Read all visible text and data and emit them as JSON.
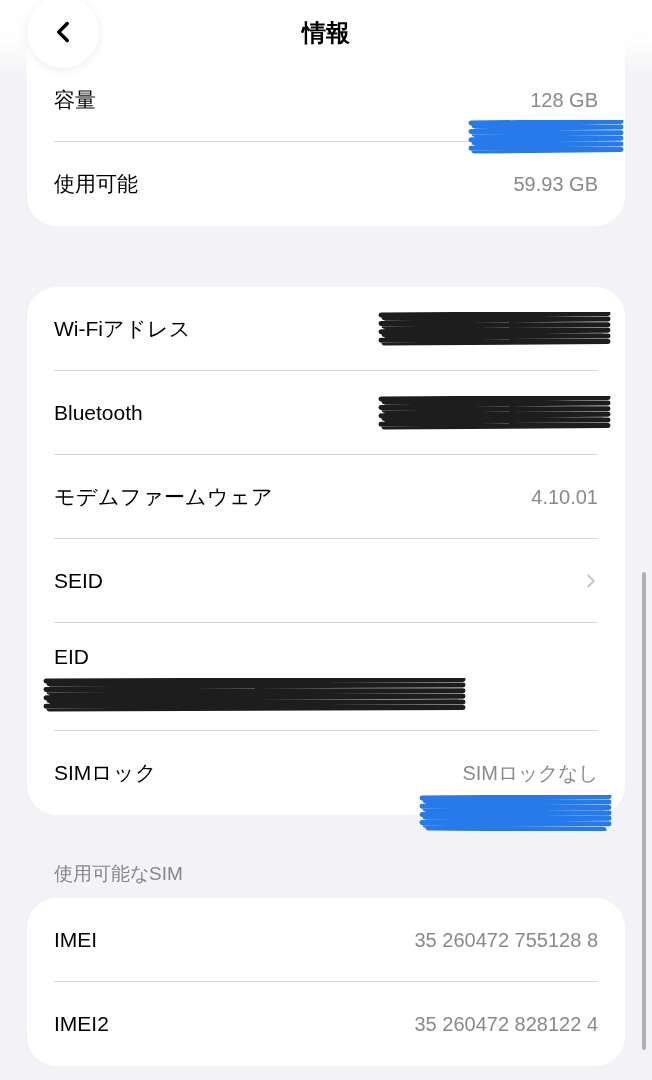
{
  "nav": {
    "title": "情報"
  },
  "cards": [
    {
      "rows": [
        {
          "kind": "value",
          "label": "容量",
          "value": "128 GB"
        },
        {
          "kind": "value",
          "label": "使用可能",
          "value": "59.93 GB"
        }
      ]
    },
    {
      "rows": [
        {
          "kind": "redacted",
          "label": "Wi-Fiアドレス"
        },
        {
          "kind": "redacted",
          "label": "Bluetooth"
        },
        {
          "kind": "value",
          "label": "モデムファームウェア",
          "value": "4.10.01"
        },
        {
          "kind": "link",
          "label": "SEID"
        },
        {
          "kind": "stacked",
          "label": "EID"
        },
        {
          "kind": "value",
          "label": "SIMロック",
          "value": "SIMロックなし"
        }
      ]
    },
    {
      "header": "使用可能なSIM",
      "rows": [
        {
          "kind": "value",
          "label": "IMEI",
          "value": "35 260472 755128 8"
        },
        {
          "kind": "value",
          "label": "IMEI2",
          "value": "35 260472 828122 4"
        }
      ]
    }
  ]
}
